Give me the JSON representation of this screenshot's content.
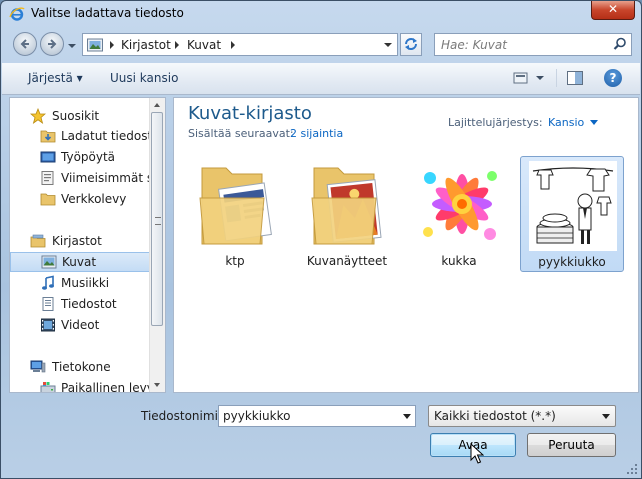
{
  "window": {
    "title": "Valitse ladattava tiedosto",
    "close_label": "✕"
  },
  "address": {
    "segments": [
      "Kirjastot",
      "Kuvat"
    ]
  },
  "search": {
    "placeholder": "Hae: Kuvat"
  },
  "toolbar": {
    "organize_label": "Järjestä ▾",
    "new_folder_label": "Uusi kansio",
    "help_label": "?"
  },
  "nav": {
    "favorites": {
      "label": "Suosikit",
      "items": [
        "Ladatut tiedostot",
        "Työpöytä",
        "Viimeisimmät sijainnit",
        "Verkkolevy"
      ]
    },
    "libraries": {
      "label": "Kirjastot",
      "items": [
        "Kuvat",
        "Musiikki",
        "Tiedostot",
        "Videot"
      ],
      "selected": "Kuvat"
    },
    "computer": {
      "label": "Tietokone",
      "items": [
        "Paikallinen levy ("
      ]
    }
  },
  "content": {
    "title": "Kuvat-kirjasto",
    "subtitle": "Sisältää seuraavat:",
    "locations_link": "2 sijaintia",
    "sort_label": "Lajittelujärjestys:",
    "sort_value": "Kansio",
    "items": [
      {
        "label": "ktp",
        "kind": "folder"
      },
      {
        "label": "Kuvanäytteet",
        "kind": "folder"
      },
      {
        "label": "kukka",
        "kind": "image"
      },
      {
        "label": "pyykkiukko",
        "kind": "image",
        "selected": true
      }
    ]
  },
  "footer": {
    "filename_label": "Tiedostonimi:",
    "filename_value": "pyykkiukko",
    "filetype_value": "Kaikki tiedostot (*.*)",
    "open_label": "Avaa",
    "cancel_label": "Peruuta"
  },
  "colors": {
    "accent": "#1d5a8c",
    "link": "#0b66c3",
    "selection": "#c4dcf5"
  }
}
